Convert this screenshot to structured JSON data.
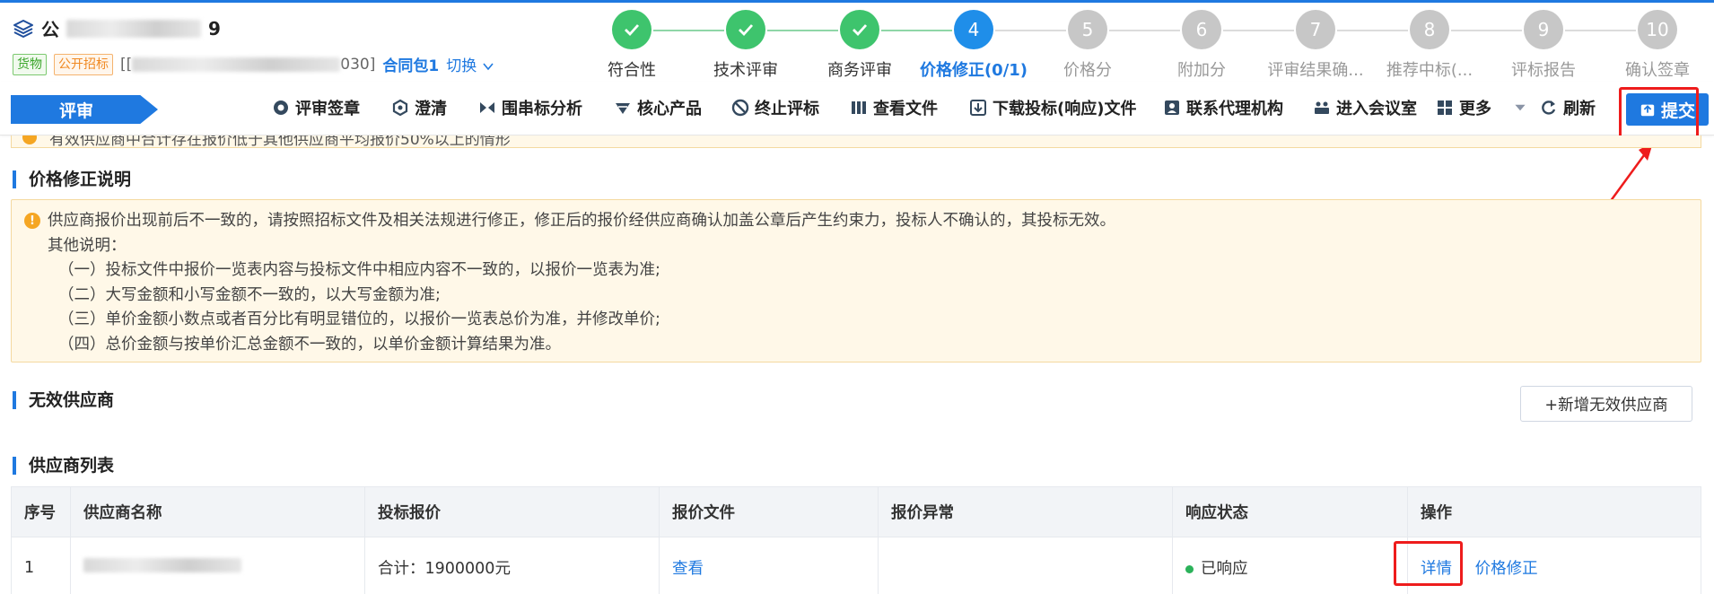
{
  "header": {
    "project_title_prefix": "公",
    "project_title_suffix": "9",
    "tags": [
      "货物",
      "公开招标"
    ],
    "code_prefix": "[[",
    "code_suffix": "030]",
    "contract_pack": "合同包1",
    "switch_label": "切换"
  },
  "steps": [
    {
      "num": "1",
      "label": "符合性",
      "state": "done"
    },
    {
      "num": "2",
      "label": "技术评审",
      "state": "done"
    },
    {
      "num": "3",
      "label": "商务评审",
      "state": "done"
    },
    {
      "num": "4",
      "label": "价格修正(0/1)",
      "state": "active"
    },
    {
      "num": "5",
      "label": "价格分",
      "state": "todo"
    },
    {
      "num": "6",
      "label": "附加分",
      "state": "todo"
    },
    {
      "num": "7",
      "label": "评审结果确...",
      "state": "todo"
    },
    {
      "num": "8",
      "label": "推荐中标(...",
      "state": "todo"
    },
    {
      "num": "9",
      "label": "评标报告",
      "state": "todo"
    },
    {
      "num": "10",
      "label": "确认签章",
      "state": "todo"
    }
  ],
  "toolbar": {
    "stage_label": "评审",
    "items": [
      {
        "label": "评审签章",
        "icon": "seal-icon"
      },
      {
        "label": "澄清",
        "icon": "clarify-icon"
      },
      {
        "label": "围串标分析",
        "icon": "analysis-icon"
      },
      {
        "label": "核心产品",
        "icon": "core-product-icon"
      },
      {
        "label": "终止评标",
        "icon": "stop-icon"
      },
      {
        "label": "查看文件",
        "icon": "files-icon"
      },
      {
        "label": "下载投标(响应)文件",
        "icon": "download-icon"
      },
      {
        "label": "联系代理机构",
        "icon": "contact-icon"
      },
      {
        "label": "进入会议室",
        "icon": "meeting-icon"
      },
      {
        "label": "更多",
        "icon": "more-icon"
      },
      {
        "label": "刷新",
        "icon": "refresh-icon"
      }
    ],
    "submit_label": "提交"
  },
  "top_warning": "有效供应商中合计存在报价低于其他供应商平均报价50%以上的情形",
  "price_fix": {
    "title": "价格修正说明",
    "lines": [
      "供应商报价出现前后不一致的，请按照招标文件及相关法规进行修正，修正后的报价经供应商确认加盖公章后产生约束力，投标人不确认的，其投标无效。",
      "其他说明：",
      "（一）投标文件中报价一览表内容与投标文件中相应内容不一致的，以报价一览表为准;",
      "（二）大写金额和小写金额不一致的，以大写金额为准;",
      "（三）单价金额小数点或者百分比有明显错位的，以报价一览表总价为准，并修改单价;",
      "（四）总价金额与按单价汇总金额不一致的，以单价金额计算结果为准。"
    ]
  },
  "invalid_suppliers": {
    "title": "无效供应商",
    "add_button": "+新增无效供应商"
  },
  "supplier_list": {
    "title": "供应商列表",
    "columns": [
      "序号",
      "供应商名称",
      "投标报价",
      "报价文件",
      "报价异常",
      "响应状态",
      "操作"
    ],
    "rows": [
      {
        "index": "1",
        "name_prefix": "",
        "price": "合计：1900000元",
        "file_link": "查看",
        "anomaly": "",
        "status": "已响应",
        "action_detail": "详情",
        "action_fix": "价格修正"
      }
    ]
  },
  "colors": {
    "accent": "#1f79e0",
    "done": "#3ec46d",
    "todo": "#c7c7c7",
    "highlight": "#ee1c1c",
    "warning_bg": "#fff8e8"
  }
}
